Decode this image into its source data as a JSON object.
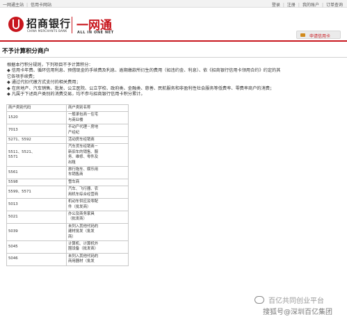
{
  "topbar": {
    "left_links": [
      "一网通主站",
      "信用卡网站"
    ],
    "right_links": [
      "登录",
      "注册",
      "我的账户",
      "订单查询"
    ]
  },
  "header": {
    "bank_name": "招商银行",
    "bank_name_en": "CHINA MERCHANTS BANK",
    "net_name": "一网通",
    "net_name_en": "ALL IN ONE NET",
    "apply_button": "申请信用卡",
    "brand_color": "#c8161d"
  },
  "page_title": "不予计算积分商户",
  "intro": [
    "根据本行积分规则，下列项目不予计算积分：",
    "◆ 信用卡年费、循环信用利息、预借现金的手续费及利息、逾期缴款所衍生的费用（如违约金、利息）、依《招商银行信用卡领用合约》约定的其",
    "它各项手续费；",
    "◆ 通过代扣代缴方式支付的相关费用；",
    "◆ 在房地产、汽车销售、批发、公立医院、公立学校、政府类、金融类、慈善、民航服务和非盈利性社会服务等低费率、零费率商户的消费；",
    "◆ 凡属于下述商户类别的消费交易，均不参与招商银行信用卡积分累计。"
  ],
  "table": {
    "headers": [
      "商户类别代码",
      "商户类别名称"
    ],
    "rows": [
      {
        "code": "1520",
        "name": [
          "一般承包商－住宅",
          "与商业楼"
        ]
      },
      {
        "code": "7013",
        "name": [
          "不动产代理－房地",
          "产经纪"
        ]
      },
      {
        "code": "5271、5592",
        "name": [
          "活动房车经销商"
        ]
      },
      {
        "code": "5511、5521、\n5571",
        "name": [
          "汽车货车经销商－",
          "新旧车的销售、服",
          "务、维修、零件及",
          "出租"
        ]
      },
      {
        "code": "5561",
        "name": [
          "旅行拖车、娱乐用",
          "车销售商"
        ]
      },
      {
        "code": "5598",
        "name": [
          "雪车商"
        ]
      },
      {
        "code": "5599、5571",
        "name": [
          "汽车、飞行器、农",
          "用机车综合经营商"
        ]
      },
      {
        "code": "5013",
        "name": [
          "机动车供应及零配",
          "件（批发商）"
        ]
      },
      {
        "code": "5021",
        "name": [
          "办公及商务家具",
          "（批发商）"
        ]
      },
      {
        "code": "5039",
        "name": [
          "未列入其他代码的",
          "建材批发（批发",
          "商）"
        ]
      },
      {
        "code": "5045",
        "name": [
          "计算机、计算机外",
          "围设备（批发商）"
        ]
      },
      {
        "code": "5046",
        "name": [
          "未列入其他代码的",
          "商用器材（批发"
        ]
      }
    ]
  },
  "watermark": {
    "line1": "百亿共同创业平台",
    "line2": "搜狐号@深圳百亿集团"
  }
}
